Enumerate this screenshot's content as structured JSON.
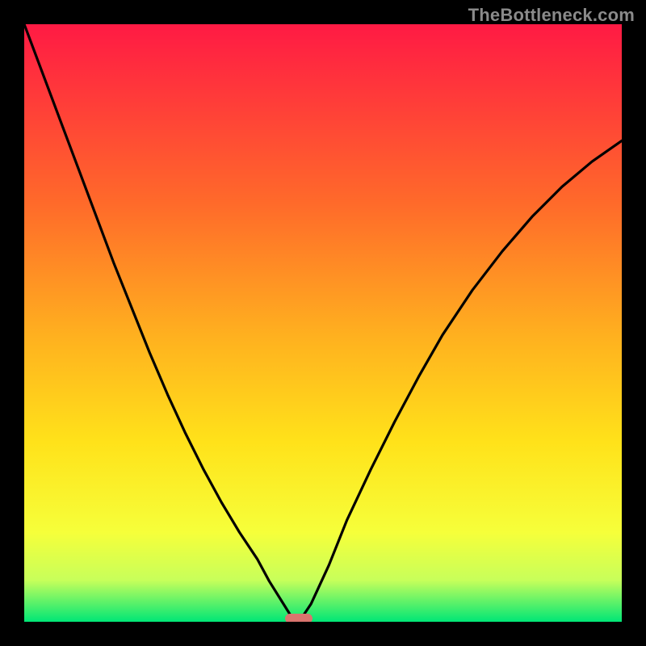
{
  "watermark": "TheBottleneck.com",
  "colors": {
    "frame_bg": "#000000",
    "grad_top": "#ff1a44",
    "grad_mid1": "#ff6a2a",
    "grad_mid2": "#ffb01f",
    "grad_mid3": "#ffe21a",
    "grad_mid4": "#f6ff3a",
    "grad_mid5": "#c8ff5a",
    "grad_bottom": "#00e676",
    "curve": "#000000",
    "marker": "#d9746e"
  },
  "chart_data": {
    "type": "line",
    "title": "",
    "xlabel": "",
    "ylabel": "",
    "xlim": [
      0,
      100
    ],
    "ylim": [
      0,
      100
    ],
    "x": [
      0,
      3,
      6,
      9,
      12,
      15,
      18,
      21,
      24,
      27,
      30,
      33,
      36,
      39,
      41,
      43,
      44.5,
      46,
      48,
      51,
      54,
      58,
      62,
      66,
      70,
      75,
      80,
      85,
      90,
      95,
      100
    ],
    "values": [
      100,
      92,
      84,
      76,
      68,
      60,
      52.5,
      45,
      38,
      31.5,
      25.5,
      20,
      15,
      10.5,
      6.8,
      3.6,
      1.2,
      0,
      3,
      9.5,
      17,
      25.5,
      33.5,
      41,
      48,
      55.5,
      62,
      67.8,
      72.8,
      77,
      80.5
    ],
    "min_x": 46,
    "marker": {
      "x_pct": 46,
      "y_pct": 0.6
    }
  }
}
